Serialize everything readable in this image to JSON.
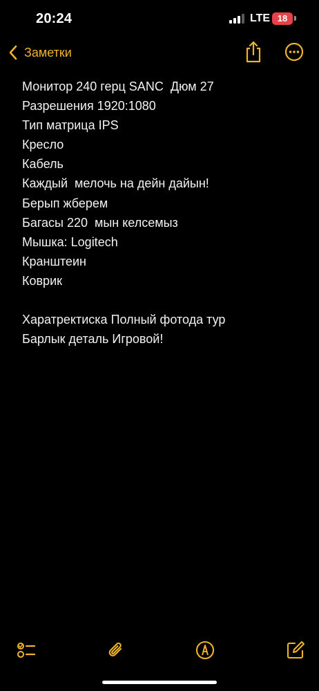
{
  "status_bar": {
    "time": "20:24",
    "network": "LTE",
    "battery": "18",
    "icons": [
      "cellular-signal-icon",
      "battery-icon"
    ]
  },
  "nav": {
    "back_label": "Заметки",
    "icons": [
      "chevron-left-icon",
      "share-icon",
      "more-icon"
    ]
  },
  "note": {
    "lines": [
      "Монитор 240 герц SANC  Дюм 27",
      "Разрешения 1920:1080",
      "Тип матрица IPS",
      "Кресло",
      "Кабель",
      "Каждый  мелочь на дейн дайын!",
      "Берып жберем",
      "Багасы 220  мын келсемыз",
      "Мышка: Logitech",
      "Кранштеин",
      "Коврик",
      "",
      "Харатректиска Полный фотода тур",
      "Барлык деталь Игровой!"
    ]
  },
  "toolbar": {
    "icons": [
      "checklist-icon",
      "attachment-icon",
      "markup-icon",
      "compose-icon"
    ]
  },
  "colors": {
    "accent": "#f0b42c",
    "background": "#000000",
    "text": "#f2f2f2",
    "battery_low": "#e5424a"
  }
}
